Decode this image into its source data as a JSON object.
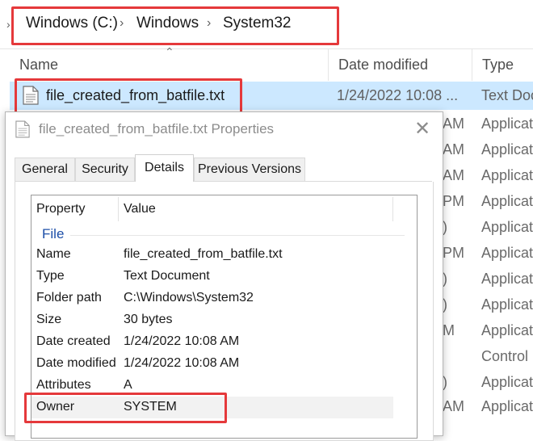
{
  "breadcrumb": {
    "items": [
      "Windows (C:)",
      "Windows",
      "System32"
    ]
  },
  "columns": {
    "name": "Name",
    "date_modified": "Date modified",
    "type": "Type"
  },
  "selected_file": {
    "name": "file_created_from_batfile.txt",
    "date": "1/24/2022 10:08 ...",
    "type": "Text Doc"
  },
  "background_rows": [
    {
      "time": "AM",
      "type": "Applicat"
    },
    {
      "time": "AM",
      "type": "Applicat"
    },
    {
      "time": "AM",
      "type": "Applicat"
    },
    {
      "time": "PM",
      "type": "Applicat"
    },
    {
      "time": ")",
      "type": "Applicat"
    },
    {
      "time": "PM",
      "type": "Applicat"
    },
    {
      "time": ")",
      "type": "Applicat"
    },
    {
      "time": ")",
      "type": "Applicat"
    },
    {
      "time": "M",
      "type": "Applicat"
    },
    {
      "time": "",
      "type": "Control"
    },
    {
      "time": ")",
      "type": "Applicat"
    },
    {
      "time": "AM",
      "type": "Applicat"
    }
  ],
  "dialog": {
    "title": "file_created_from_batfile.txt Properties",
    "tabs": [
      "General",
      "Security",
      "Details",
      "Previous Versions"
    ],
    "active_tab": "Details",
    "table_header": {
      "property": "Property",
      "value": "Value"
    },
    "group": "File",
    "properties": [
      {
        "property": "Name",
        "value": "file_created_from_batfile.txt"
      },
      {
        "property": "Type",
        "value": "Text Document"
      },
      {
        "property": "Folder path",
        "value": "C:\\Windows\\System32"
      },
      {
        "property": "Size",
        "value": "30 bytes"
      },
      {
        "property": "Date created",
        "value": "1/24/2022 10:08 AM"
      },
      {
        "property": "Date modified",
        "value": "1/24/2022 10:08 AM"
      },
      {
        "property": "Attributes",
        "value": "A"
      },
      {
        "property": "Owner",
        "value": "SYSTEM"
      }
    ]
  },
  "colors": {
    "highlight_box": "#e5393b",
    "selection": "#cce8ff",
    "group_text": "#1d4fa8"
  },
  "icons": {
    "breadcrumb_lead": "chevron-right-icon",
    "separator": "chevron-right-icon",
    "sort": "chevron-up-icon",
    "file": "text-file-icon",
    "close": "close-icon"
  }
}
